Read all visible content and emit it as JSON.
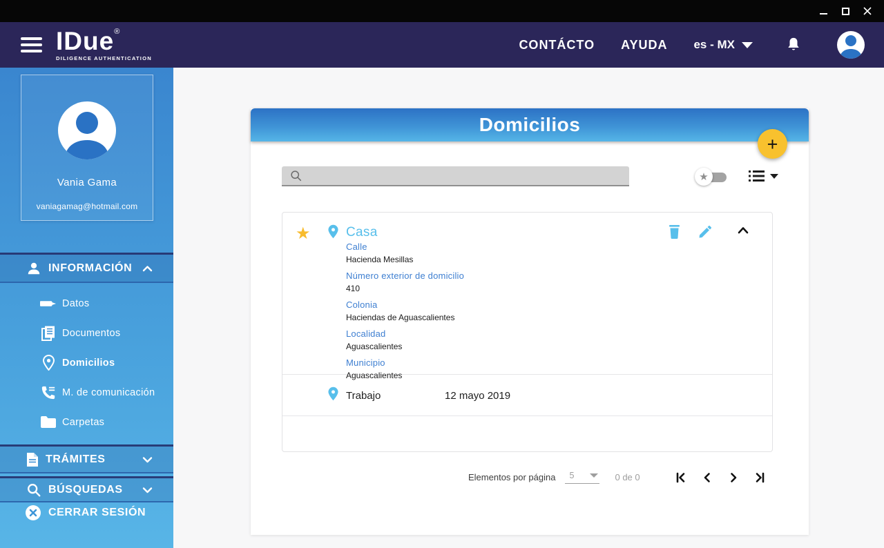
{
  "header": {
    "logo": {
      "title": "IDue",
      "registered": "®",
      "tagline": "DILIGENCE AUTHENTICATION"
    },
    "nav": [
      {
        "label": "CONTÁCTO"
      },
      {
        "label": "AYUDA"
      }
    ],
    "language": "es - MX"
  },
  "sidebar": {
    "profile": {
      "name": "Vania Gama",
      "email": "vaniagamag@hotmail.com"
    },
    "sections": [
      {
        "label": "INFORMACIÓN",
        "expanded": true,
        "items": [
          {
            "label": "Datos"
          },
          {
            "label": "Documentos"
          },
          {
            "label": "Domicilios",
            "active": true
          },
          {
            "label": "M. de comunicación"
          },
          {
            "label": "Carpetas"
          }
        ]
      },
      {
        "label": "TRÁMITES",
        "expanded": false
      },
      {
        "label": "BÚSQUEDAS",
        "expanded": false
      }
    ],
    "logout_label": "CERRAR SESIÓN"
  },
  "main": {
    "title": "Domicilios",
    "add_button": "+",
    "search": {
      "value": "",
      "placeholder": ""
    },
    "addresses": [
      {
        "name": "Casa",
        "favorite": true,
        "expanded": true,
        "fields": [
          {
            "label": "Calle",
            "value": "Hacienda Mesillas"
          },
          {
            "label": "Número exterior de domicilio",
            "value": "410"
          },
          {
            "label": "Colonia",
            "value": "Haciendas de Aguascalientes"
          },
          {
            "label": "Localidad",
            "value": "Aguascalientes"
          },
          {
            "label": "Municipio",
            "value": "Aguascalientes"
          }
        ]
      },
      {
        "name": "Trabajo",
        "date": "12 mayo 2019"
      }
    ],
    "pagination": {
      "label": "Elementos por página",
      "page_size": "5",
      "range": "0 de 0"
    }
  },
  "icons": {
    "star": "★"
  },
  "colors": {
    "header_navy": "#2b2659",
    "sidebar_top": "#3a86cf",
    "sidebar_bottom": "#58b5e7",
    "panel_header_top": "#2c72c5",
    "panel_header_bottom": "#55b5e7",
    "accent_light_blue": "#58bfeb",
    "label_blue": "#3e7fd1",
    "fab_yellow": "#f8c12e",
    "favorite_yellow": "#f8bc2e"
  }
}
